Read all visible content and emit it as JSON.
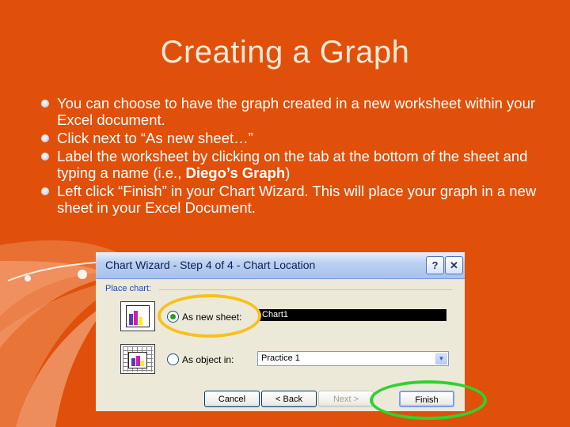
{
  "slide": {
    "title": "Creating a Graph",
    "bullets": [
      "You can choose to have the graph created in a new worksheet within your Excel document.",
      "Click next to “As new sheet…”",
      "Label the worksheet by clicking on the tab at the bottom of the sheet and typing a name (i.e., ",
      "Left click “Finish” in your Chart Wizard. This will place your graph in a new sheet in your Excel Document."
    ],
    "bullet3_bold": "Diego’s Graph",
    "bullet3_end": ")"
  },
  "dialog": {
    "title": "Chart Wizard - Step 4 of 4 - Chart Location",
    "help_glyph": "?",
    "close_glyph": "✕",
    "section_label": "Place chart:",
    "option_new_sheet": "As new sheet:",
    "new_sheet_value": "Chart1",
    "option_as_object": "As object in:",
    "object_value": "Practice 1",
    "buttons": {
      "cancel": "Cancel",
      "back": "< Back",
      "next": "Next >",
      "finish": "Finish"
    },
    "icons": {
      "new_sheet": "chart-sheet-icon",
      "as_object": "embedded-chart-icon"
    }
  },
  "colors": {
    "background": "#E0500A",
    "highlight_yellow": "#F6C11C",
    "highlight_green": "#2FD22E"
  }
}
